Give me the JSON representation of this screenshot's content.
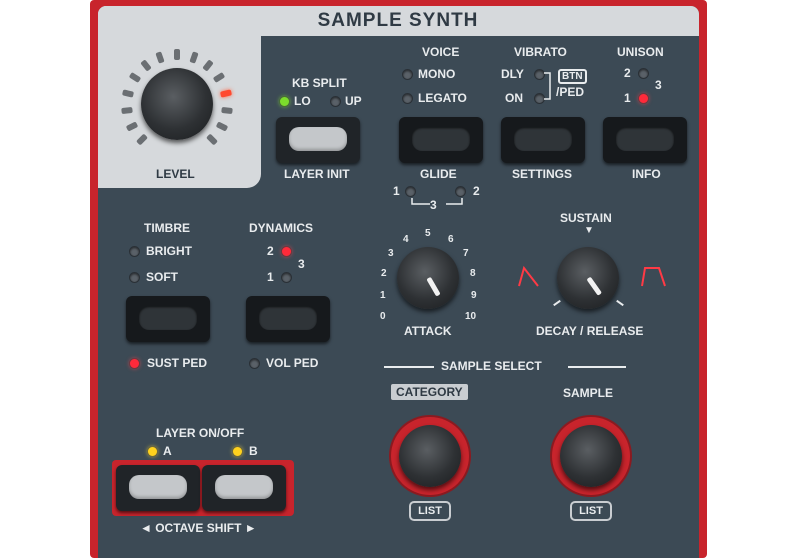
{
  "module": {
    "title": "SAMPLE SYNTH"
  },
  "level": {
    "label": "LEVEL"
  },
  "kb_split": {
    "label": "KB SPLIT",
    "lo": "LO",
    "up": "UP"
  },
  "layer_init": {
    "label": "LAYER INIT"
  },
  "voice": {
    "label": "VOICE",
    "mono": "MONO",
    "legato": "LEGATO",
    "glide_label": "GLIDE",
    "glide_1": "1",
    "glide_2": "2",
    "glide_3": "3"
  },
  "vibrato": {
    "label": "VIBRATO",
    "dly": "DLY",
    "on": "ON",
    "btn": "BTN",
    "ped": "/PED",
    "settings_label": "SETTINGS"
  },
  "unison": {
    "label": "UNISON",
    "u2": "2",
    "u3": "3",
    "u1": "1",
    "info_label": "INFO"
  },
  "timbre": {
    "label": "TIMBRE",
    "bright": "BRIGHT",
    "soft": "SOFT",
    "sust_ped": "SUST PED"
  },
  "dynamics": {
    "label": "DYNAMICS",
    "d2": "2",
    "d3": "3",
    "d1": "1",
    "vol_ped": "VOL PED"
  },
  "attack": {
    "label": "ATTACK",
    "scale": [
      "0",
      "1",
      "2",
      "3",
      "4",
      "5",
      "6",
      "7",
      "8",
      "9",
      "10"
    ]
  },
  "decay_release": {
    "label": "DECAY / RELEASE",
    "sustain": "SUSTAIN",
    "sustain_arrow": "▼"
  },
  "sample_select": {
    "label": "SAMPLE SELECT",
    "category": "CATEGORY",
    "sample": "SAMPLE",
    "list_left": "LIST",
    "list_right": "LIST"
  },
  "layer_onoff": {
    "label": "LAYER ON/OFF",
    "a": "A",
    "b": "B",
    "octave_shift": "◄ OCTAVE SHIFT ►"
  },
  "colors": {
    "panel": "#3c4a55",
    "frame": "#c8242c",
    "led_red": "#ff2a3a",
    "led_green": "#7cdc2c",
    "led_yellow": "#ffd21e"
  }
}
